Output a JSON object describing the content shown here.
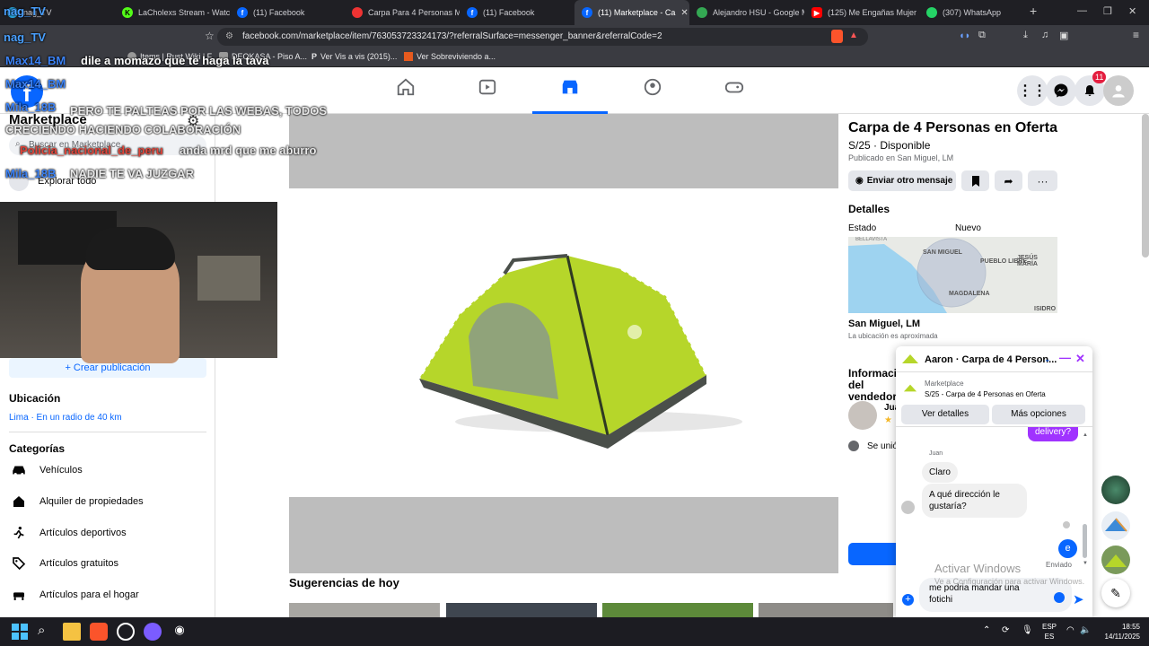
{
  "browser": {
    "tabs": [
      {
        "label": "nag_TV"
      },
      {
        "label": "LaCholexs Stream - Watch"
      },
      {
        "label": "(11) Facebook"
      },
      {
        "label": "Carpa Para 4 Personas Mo"
      },
      {
        "label": "(11) Facebook"
      },
      {
        "label": "(11) Marketplace - Ca"
      },
      {
        "label": "Alejandro HSU - Google M"
      },
      {
        "label": "(125) Me Engañas Mujer"
      },
      {
        "label": "(307) WhatsApp"
      }
    ],
    "url": "facebook.com/marketplace/item/763053723324173/?referralSurface=messenger_banner&referralCode=2",
    "bookmarks": [
      "Items | Rust Wiki | F...",
      "DEOKASA - Piso A...",
      "Ver Vis a vis (2015)...",
      "Ver Sobreviviendo a..."
    ]
  },
  "fb": {
    "notif_count": "11"
  },
  "sidebar": {
    "title": "Marketplace",
    "search_placeholder": "Buscar en Marketplace",
    "explore": "Explorar todo",
    "create_btn": "+ Crear publicación",
    "location_heading": "Ubicación",
    "location_value": "Lima · En un radio de 40 km",
    "categories_heading": "Categorías",
    "categories": [
      {
        "label": "Vehículos",
        "icon": "car-icon"
      },
      {
        "label": "Alquiler de propiedades",
        "icon": "house-icon"
      },
      {
        "label": "Artículos deportivos",
        "icon": "sports-icon"
      },
      {
        "label": "Artículos gratuitos",
        "icon": "tag-icon"
      },
      {
        "label": "Artículos para el hogar",
        "icon": "home-goods-icon"
      }
    ]
  },
  "listing": {
    "title": "Carpa de 4 Personas en Oferta",
    "price_status": "S/25 · Disponible",
    "published": "Publicado en San Miguel, LM",
    "send_btn": "Enviar otro mensaje",
    "details_heading": "Detalles",
    "state_label": "Estado",
    "state_value": "Nuevo",
    "map_labels": [
      "SAN MIGUEL",
      "PUEBLO LIBRE",
      "JESÚS MARÍA",
      "MAGDALENA",
      "ISIDRO",
      "BELLAVISTA"
    ],
    "location": "San Miguel, LM",
    "location_note": "La ubicación es aproximada",
    "seller_heading": "Información del vendedor",
    "seller_name": "Jua",
    "joined": "Se unió"
  },
  "suggestions_heading": "Sugerencias de hoy",
  "chat": {
    "header": "Aaron · Carpa de 4 Person...",
    "context_source": "Marketplace",
    "context_item": "S/25 - Carpa de 4 Personas en Oferta",
    "btn_details": "Ver detalles",
    "btn_more": "Más opciones",
    "sent_prev": "delivery?",
    "sender": "Juan",
    "msg1": "Claro",
    "msg2": "A qué dirección le gustaría?",
    "own_msg": "e",
    "sent_status": "Enviado",
    "input_text": "me podria mandar una fotichi",
    "watermark_title": "Activar Windows",
    "watermark_sub": "Ve a Configuración para activar Windows."
  },
  "overlay_chat": [
    {
      "user": "nag_TV",
      "text": ""
    },
    {
      "user": "nag_TV",
      "text": ""
    },
    {
      "user": "Max14_BM",
      "text": "dile a momazo que te haga la tava"
    },
    {
      "user": "Max14_BM",
      "text": ""
    },
    {
      "user": "Mila_18B",
      "text": "PERO TE PALTEAS POR LAS WEBAS, TODOS CRECIENDO HACIENDO COLABORACIÓN"
    },
    {
      "user": "Policia_nacional_de_peru",
      "text": "anda mrd que me aburro"
    },
    {
      "user": "Mila_18B",
      "text": "NADIE TE VA JUZGAR"
    }
  ],
  "taskbar": {
    "lang1": "ESP",
    "lang2": "ES",
    "time": "18:55",
    "date": "14/11/2025"
  },
  "colors": {
    "fb_blue": "#0866ff",
    "tent_green": "#b6d62a",
    "purple": "#a033ff"
  }
}
